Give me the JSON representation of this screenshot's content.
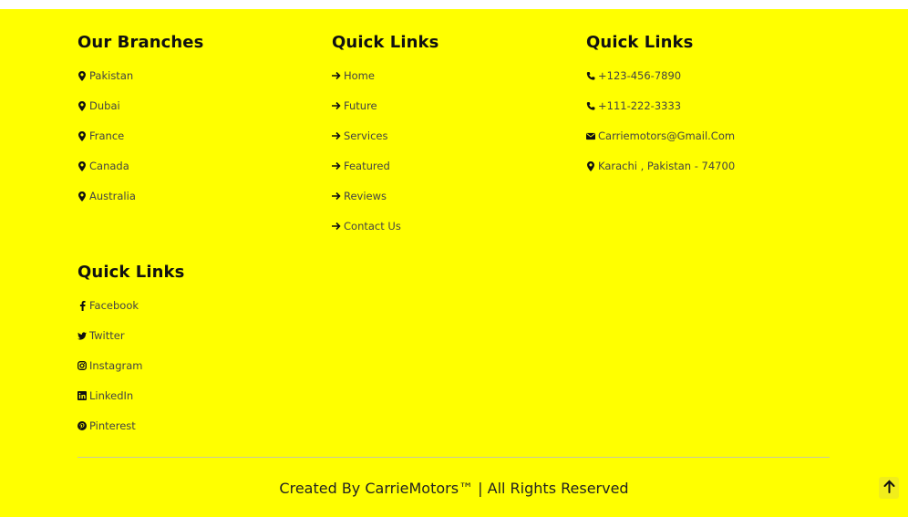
{
  "branches": {
    "heading": "Our Branches",
    "items": [
      {
        "label": "Pakistan",
        "icon": "map-marker-icon"
      },
      {
        "label": "Dubai",
        "icon": "map-marker-icon"
      },
      {
        "label": "France",
        "icon": "map-marker-icon"
      },
      {
        "label": "Canada",
        "icon": "map-marker-icon"
      },
      {
        "label": "Australia",
        "icon": "map-marker-icon"
      }
    ]
  },
  "quick_links": {
    "heading": "Quick Links",
    "items": [
      {
        "label": "Home",
        "icon": "arrow-right-icon"
      },
      {
        "label": "Future",
        "icon": "arrow-right-icon"
      },
      {
        "label": "Services",
        "icon": "arrow-right-icon"
      },
      {
        "label": "Featured",
        "icon": "arrow-right-icon"
      },
      {
        "label": "Reviews",
        "icon": "arrow-right-icon"
      },
      {
        "label": "Contact Us",
        "icon": "arrow-right-icon"
      }
    ]
  },
  "contact": {
    "heading": "Quick Links",
    "items": [
      {
        "label": "+123-456-7890",
        "icon": "phone-icon"
      },
      {
        "label": "+111-222-3333",
        "icon": "phone-icon"
      },
      {
        "label": "Carriemotors@Gmail.Com",
        "icon": "envelope-icon"
      },
      {
        "label": "Karachi , Pakistan - 74700",
        "icon": "map-marker-icon"
      }
    ]
  },
  "social": {
    "heading": "Quick Links",
    "items": [
      {
        "label": "Facebook",
        "icon": "facebook-icon"
      },
      {
        "label": "Twitter",
        "icon": "twitter-icon"
      },
      {
        "label": "Instagram",
        "icon": "instagram-icon"
      },
      {
        "label": "LinkedIn",
        "icon": "linkedin-icon"
      },
      {
        "label": "Pinterest",
        "icon": "pinterest-icon"
      }
    ]
  },
  "footer": {
    "copyright": "Created By CarrieMotors™ | All Rights Reserved",
    "scroll_top_icon": "arrow-up-icon"
  },
  "colors": {
    "background": "#ffff00",
    "heading": "#111111",
    "text": "#444444"
  }
}
